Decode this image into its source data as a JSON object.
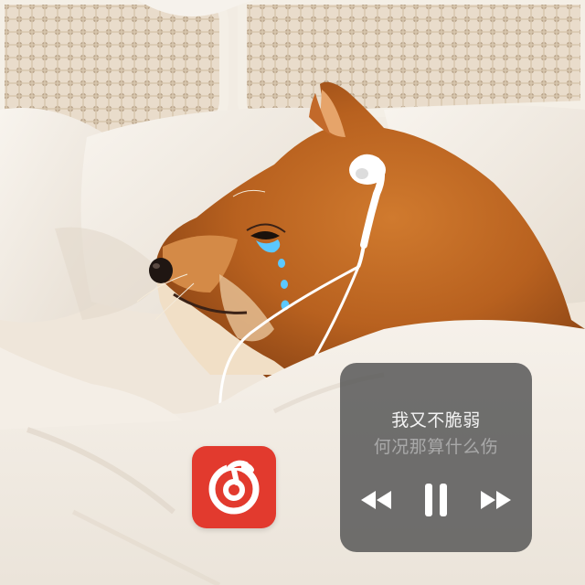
{
  "player": {
    "lyric_current": "我又不脆弱",
    "lyric_next": "何况那算什么伤",
    "controls": {
      "previous_icon": "rewind-icon",
      "pause_icon": "pause-icon",
      "next_icon": "fast-forward-icon"
    }
  },
  "app_icon": {
    "name": "music-app-icon",
    "color": "#e23a2e"
  },
  "colors": {
    "card_bg": "#585858",
    "lyric_primary": "#f3f3f3",
    "lyric_secondary": "#a9a9a9",
    "tear": "#5bc8ff"
  }
}
